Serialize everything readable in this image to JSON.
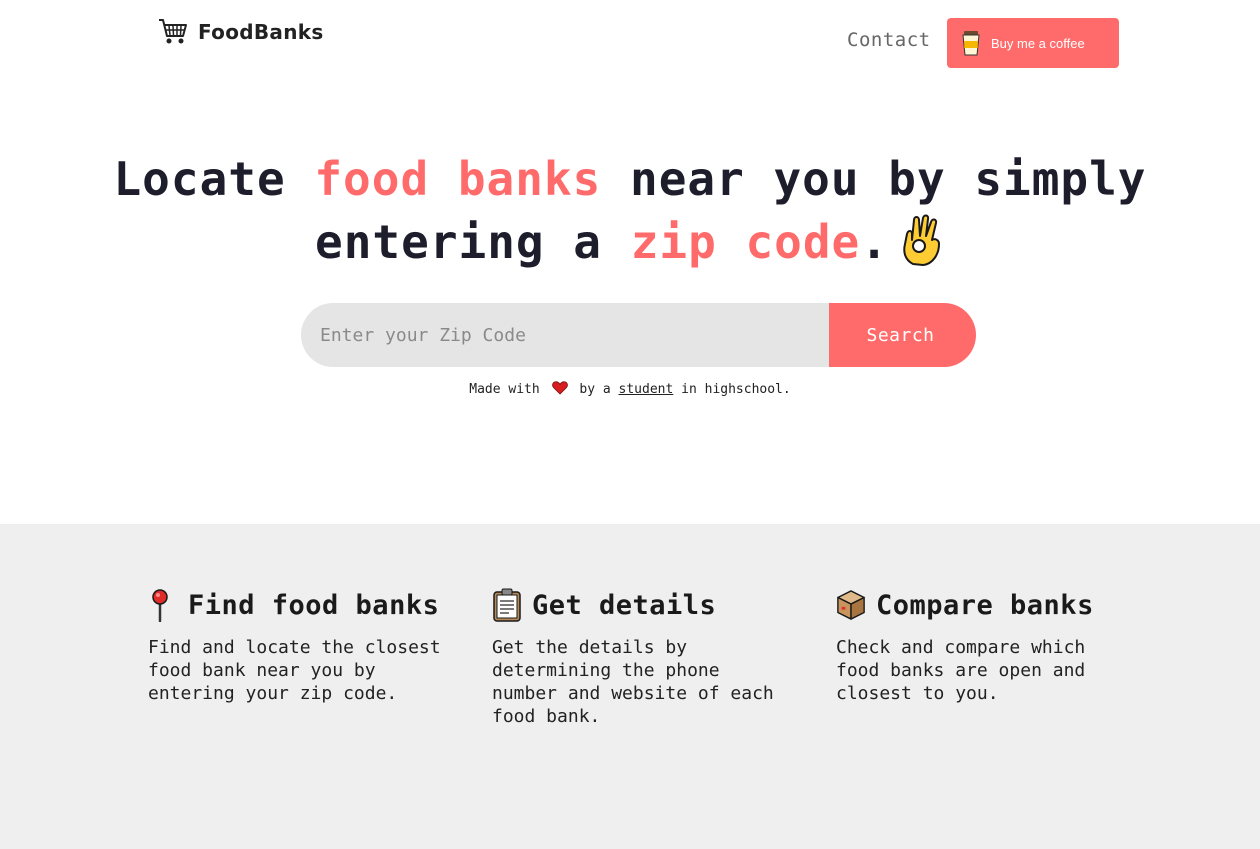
{
  "header": {
    "brand_name": "FoodBanks",
    "brand_icon": "shopping-cart-icon",
    "contact_label": "Contact",
    "coffee_label": "Buy me a coffee",
    "coffee_icon": "coffee-cup-icon"
  },
  "hero": {
    "title_part1": "Locate ",
    "title_accent1": "food banks",
    "title_part2": " near you by simply entering a ",
    "title_accent2": "zip code",
    "title_part3": ".",
    "title_icon": "ok-hand-icon"
  },
  "search": {
    "placeholder": "Enter your Zip Code",
    "value": "",
    "button_label": "Search"
  },
  "footer_note": {
    "prefix": "Made with",
    "middle": "by a",
    "link": "student",
    "suffix": "in highschool."
  },
  "features": [
    {
      "icon": "pushpin-icon",
      "title": "Find food banks",
      "text": "Find and locate the closest food bank near you by entering your zip code."
    },
    {
      "icon": "clipboard-icon",
      "title": "Get details",
      "text": "Get the details by determining the phone number and website of each food bank."
    },
    {
      "icon": "package-icon",
      "title": "Compare banks",
      "text": "Check and compare which food banks are open and closest to you."
    }
  ],
  "colors": {
    "accent": "#ff6b6b",
    "text_dark": "#1d1d2c",
    "input_bg": "#e5e5e5",
    "features_bg": "#efefef"
  }
}
